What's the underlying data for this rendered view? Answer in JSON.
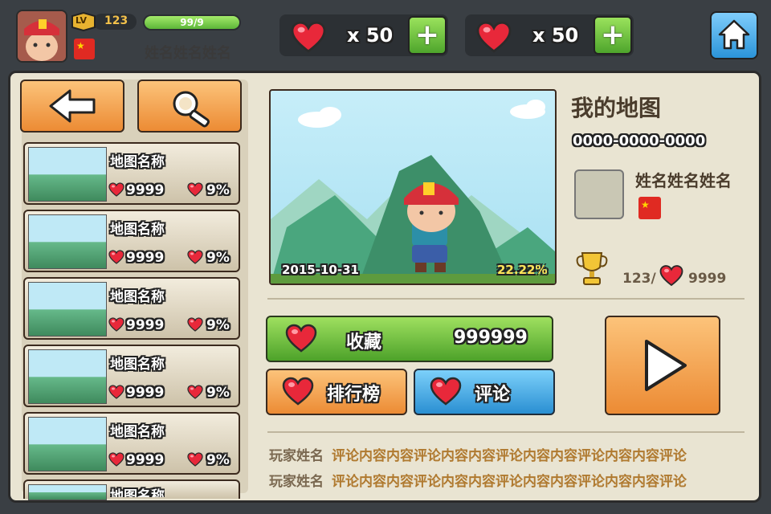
{
  "player": {
    "level_label": "LV",
    "level": "123",
    "xp_text": "99/9",
    "name": "姓名姓名姓名",
    "flag": "china-flag"
  },
  "resources": [
    {
      "icon": "heart-icon",
      "count": "x 50",
      "plus_label": "+"
    },
    {
      "icon": "heart-icon",
      "count": "x 50",
      "plus_label": "+"
    }
  ],
  "nav": {
    "home_icon": "home-icon",
    "back_icon": "arrow-left-icon",
    "search_icon": "search-icon"
  },
  "map_list": [
    {
      "name": "地图名称",
      "likes": "9999",
      "rate": "9%"
    },
    {
      "name": "地图名称",
      "likes": "9999",
      "rate": "9%"
    },
    {
      "name": "地图名称",
      "likes": "9999",
      "rate": "9%"
    },
    {
      "name": "地图名称",
      "likes": "9999",
      "rate": "9%"
    },
    {
      "name": "地图名称",
      "likes": "9999",
      "rate": "9%"
    },
    {
      "name": "地图名称",
      "likes": "",
      "rate": ""
    }
  ],
  "detail": {
    "preview_date": "2015-10-31",
    "preview_percent": "22.22%",
    "title": "我的地图",
    "code": "0000-0000-0000",
    "author_name": "姓名姓名姓名",
    "author_flag": "china-flag",
    "rank": "123/",
    "rank_likes": "9999"
  },
  "actions": {
    "favorite_label": "收藏",
    "favorite_count": "999999",
    "ranking_label": "排行榜",
    "comment_label": "评论",
    "play_icon": "play-icon"
  },
  "comments": [
    {
      "user": "玩家姓名",
      "text": "评论内容内容评论内容内容评论内容内容评论内容内容评论"
    },
    {
      "user": "玩家姓名",
      "text": "评论内容内容评论内容内容评论内容内容评论内容内容评论"
    }
  ],
  "colors": {
    "green_button": "#5cb638",
    "orange_button": "#ec8b34",
    "blue_button": "#2a8fd2",
    "heart_red": "#e8283a",
    "panel_bg": "#e9e4d2"
  }
}
